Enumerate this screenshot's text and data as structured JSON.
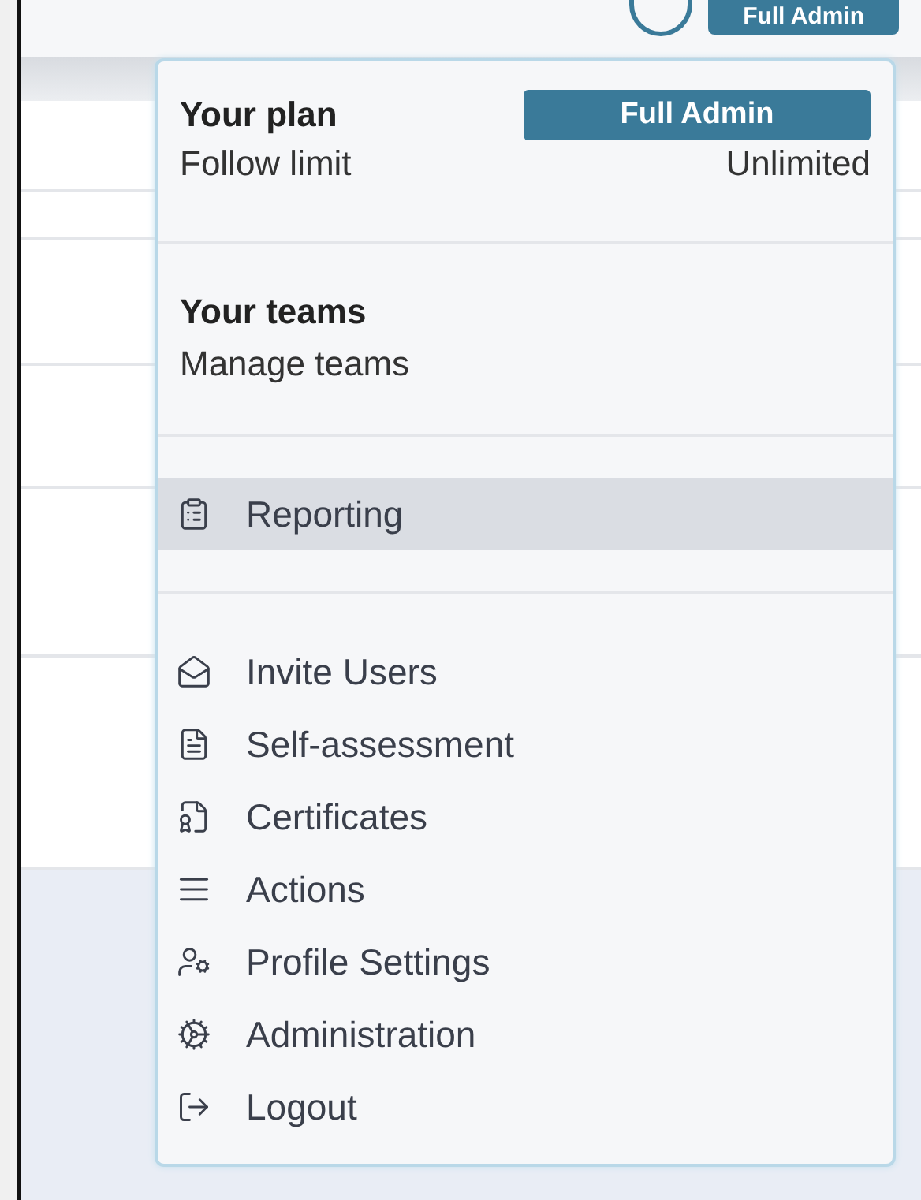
{
  "header": {
    "role_badge": "Full Admin"
  },
  "menu": {
    "plan": {
      "title": "Your plan",
      "badge": "Full Admin",
      "label": "Follow limit",
      "value": "Unlimited"
    },
    "teams": {
      "title": "Your teams",
      "link": "Manage teams"
    },
    "groups": [
      {
        "items": [
          {
            "label": "Reporting",
            "selected": true
          }
        ]
      },
      {
        "items": [
          {
            "label": "Invite Users",
            "selected": false
          },
          {
            "label": "Self-assessment",
            "selected": false
          },
          {
            "label": "Certificates",
            "selected": false
          },
          {
            "label": "Actions",
            "selected": false
          },
          {
            "label": "Profile Settings",
            "selected": false
          },
          {
            "label": "Administration",
            "selected": false
          },
          {
            "label": "Logout",
            "selected": false
          }
        ]
      }
    ]
  }
}
